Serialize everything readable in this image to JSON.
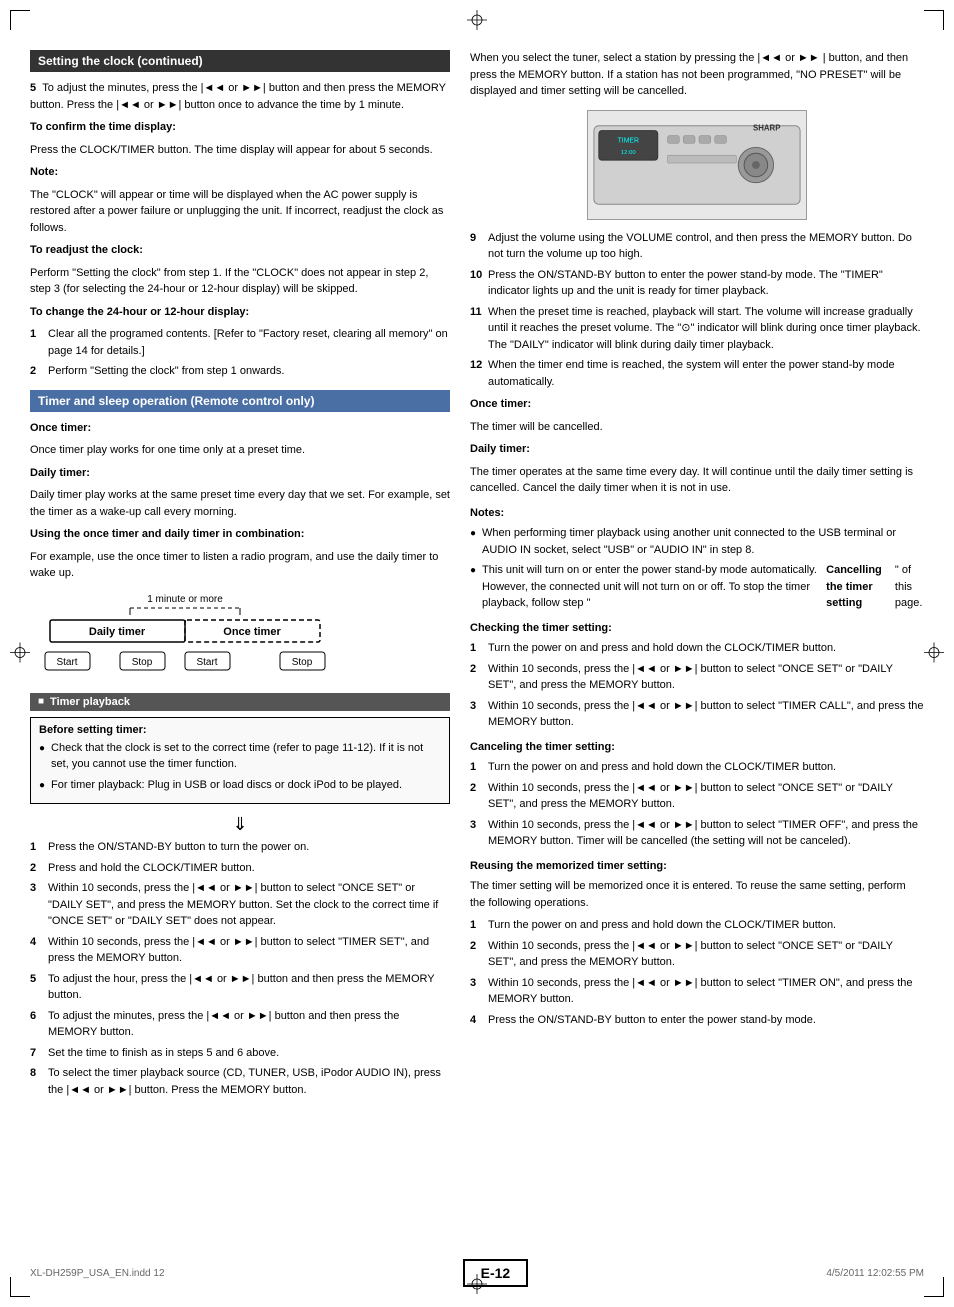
{
  "page": {
    "title": "E-12",
    "file_info": "XL-DH259P_USA_EN.indd   12",
    "date_info": "4/5/2011   12:02:55 PM"
  },
  "left_column": {
    "section1": {
      "header": "Setting the clock (continued)",
      "item5": "To adjust the minutes, press the |◄◄ or ►►| button and then press the MEMORY button. Press the |◄◄ or ►►| button once to advance the time by 1 minute.",
      "confirm_title": "To confirm the time display:",
      "confirm_text": "Press the CLOCK/TIMER button. The time display will appear for about 5 seconds.",
      "note_title": "Note:",
      "note_text": "The \"CLOCK\" will appear or time will be displayed when the AC power supply is restored after a power failure or unplugging the unit. If incorrect, readjust the clock as follows.",
      "readjust_title": "To readjust the clock:",
      "readjust_text": "Perform \"Setting the clock\" from step 1. If the \"CLOCK\" does not appear in step 2, step 3 (for selecting the 24-hour or 12-hour display) will be skipped.",
      "change24_title": "To change the 24-hour or 12-hour display:",
      "change24_items": [
        "Clear all the programed contents. [Refer to \"Factory reset, clearing all memory\" on page 14 for details.]",
        "Perform \"Setting the clock\" from step 1 onwards."
      ]
    },
    "section2": {
      "header": "Timer and sleep operation (Remote control only)",
      "once_timer_title": "Once timer:",
      "once_timer_text": "Once timer play works for one time only at a preset time.",
      "daily_timer_title": "Daily timer:",
      "daily_timer_text": "Daily timer play works at the same preset time every day that we set. For example, set the timer as a wake-up call every morning.",
      "combo_title": "Using the once timer and daily timer in combination:",
      "combo_text": "For example, use the once timer to listen a radio program, and use the daily timer to wake up.",
      "diagram": {
        "label_top": "1 minute or more",
        "label_left": "Daily timer",
        "label_right": "Once timer",
        "btn_start1": "Start",
        "btn_stop1": "Stop",
        "btn_start2": "Start",
        "btn_stop2": "Stop"
      }
    },
    "section3": {
      "header": "Timer playback",
      "before_title": "Before setting timer:",
      "before_bullets": [
        "Check that the clock is set to the correct time (refer to page 11-12). If it is not set, you cannot use the timer function.",
        "For timer playback: Plug in USB or load discs or dock iPod to be played."
      ],
      "steps": [
        "Press the ON/STAND-BY button to turn the power on.",
        "Press and hold the CLOCK/TIMER button.",
        "Within 10 seconds, press the |◄◄ or ►►| button to select \"ONCE SET\" or \"DAILY SET\", and press the MEMORY button. Set the clock to the correct time if \"ONCE SET\" or \"DAILY SET\" does not appear.",
        "Within 10 seconds, press the |◄◄ or ►►| button to select \"TIMER SET\", and press the MEMORY button.",
        "To adjust the hour, press the |◄◄ or ►►| button and then press the MEMORY button.",
        "To adjust the minutes, press the |◄◄ or ►►| button and then press the MEMORY button.",
        "Set the time to finish as in steps 5 and 6 above.",
        "To select the timer playback source (CD, TUNER, USB, iPodor AUDIO IN), press the |◄◄ or ►►| button. Press the MEMORY button."
      ]
    }
  },
  "right_column": {
    "intro_text": "When you select the tuner, select a station by pressing the |◄◄ or ►► | button, and then press the MEMORY button. If a station has not been programmed, \"NO PRESET\" will be displayed and timer setting will be cancelled.",
    "steps_9_12": [
      "Adjust the volume using the VOLUME control, and then press the MEMORY button. Do not turn the volume up too high.",
      "Press the ON/STAND-BY button to enter the power stand-by mode. The \"TIMER\" indicator lights up and the unit is ready for timer playback.",
      "When the preset time is reached, playback will start. The volume will increase gradually until it reaches the preset volume. The \"⊙\" indicator will blink during once timer playback. The \"DAILY\" indicator will blink during daily timer playback.",
      "When the timer end time is reached, the system will enter the power stand-by mode automatically."
    ],
    "once_timer_result_title": "Once timer:",
    "once_timer_result_text": "The timer will be cancelled.",
    "daily_timer_result_title": "Daily timer:",
    "daily_timer_result_text": "The timer operates at the same time every day. It will continue until the daily timer setting is cancelled. Cancel the daily timer when it is not in use.",
    "notes_title": "Notes:",
    "notes_bullets": [
      "When performing timer playback using another unit connected to the USB terminal or AUDIO IN socket, select \"USB\" or \"AUDIO IN\" in step 8.",
      "This unit will turn on or enter the power stand-by mode automatically. However, the connected unit will not turn on or off. To stop the timer playback, follow step \"Cancelling the timer setting\" of this page."
    ],
    "checking_title": "Checking the timer setting:",
    "checking_steps": [
      "Turn the power on and press and hold down the CLOCK/TIMER button.",
      "Within 10 seconds, press the |◄◄ or ►►| button to select \"ONCE SET\" or \"DAILY SET\", and press the MEMORY button.",
      "Within 10 seconds, press the |◄◄ or ►►| button to select \"TIMER CALL\", and press the MEMORY button."
    ],
    "cancelling_title": "Canceling the timer setting:",
    "cancelling_steps": [
      "Turn the power on and press and hold down the CLOCK/TIMER button.",
      "Within 10 seconds, press the |◄◄ or ►►| button to select \"ONCE SET\" or \"DAILY SET\", and press the MEMORY button.",
      "Within 10 seconds, press the |◄◄ or ►►| button to select \"TIMER OFF\", and press the MEMORY button. Timer will be cancelled (the setting will not be canceled)."
    ],
    "reusing_title": "Reusing the memorized timer setting:",
    "reusing_intro": "The timer setting will be memorized once it is entered. To reuse the same setting, perform the following operations.",
    "reusing_steps": [
      "Turn the power on and press and hold down the CLOCK/TIMER button.",
      "Within 10 seconds, press the |◄◄ or ►►| button to select \"ONCE SET\" or \"DAILY SET\", and press the MEMORY button.",
      "Within 10 seconds, press the |◄◄ or ►►| button to select \"TIMER ON\", and press the MEMORY button.",
      "Press the ON/STAND-BY button to enter the power stand-by mode."
    ]
  }
}
